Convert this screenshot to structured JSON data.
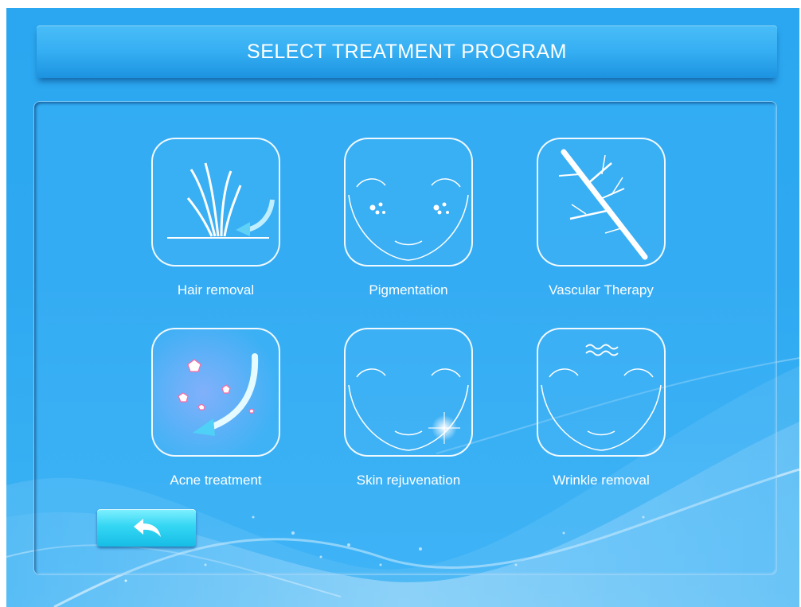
{
  "header": {
    "title": "SELECT TREATMENT PROGRAM"
  },
  "programs": [
    {
      "label": "Hair removal",
      "icon": "hair-removal-icon"
    },
    {
      "label": "Pigmentation",
      "icon": "pigmentation-face-icon"
    },
    {
      "label": "Vascular Therapy",
      "icon": "vascular-branch-icon"
    },
    {
      "label": "Acne treatment",
      "icon": "acne-treatment-icon"
    },
    {
      "label": "Skin rejuvenation",
      "icon": "skin-rejuvenation-face-icon"
    },
    {
      "label": "Wrinkle removal",
      "icon": "wrinkle-face-icon"
    }
  ],
  "back_button": {
    "icon": "back-arrow-icon"
  },
  "colors": {
    "background": "#2ea9f1",
    "title_bar": "#35aef3",
    "back_button": "#34d6f3",
    "text": "#ffffff"
  }
}
